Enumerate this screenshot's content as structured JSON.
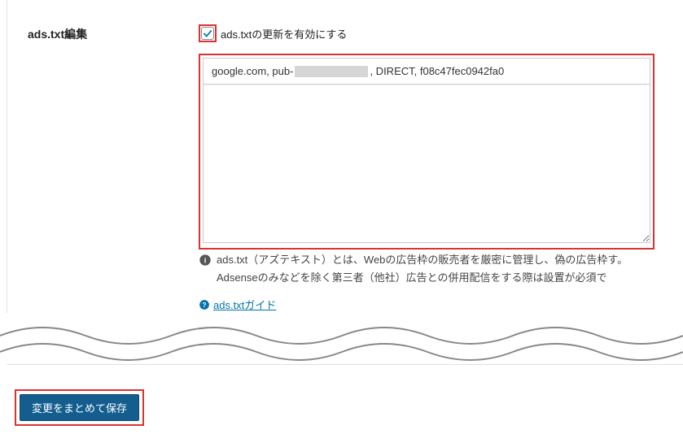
{
  "section": {
    "title": "ads.txt編集"
  },
  "checkbox": {
    "label": "ads.txtの更新を有効にする",
    "checked": true
  },
  "textarea": {
    "prefix": "google.com, pub-",
    "suffix": ", DIRECT, f08c47fec0942fa0"
  },
  "help": {
    "text": "ads.txt（アズテキスト）とは、Webの広告枠の販売者を厳密に管理し、偽の広告枠す。Adsenseのみなどを除く第三者（他社）広告との併用配信をする際は設置が必須で"
  },
  "guide_link": {
    "text": " ads.txtガイド"
  },
  "save_button": {
    "label": "変更をまとめて保存"
  }
}
